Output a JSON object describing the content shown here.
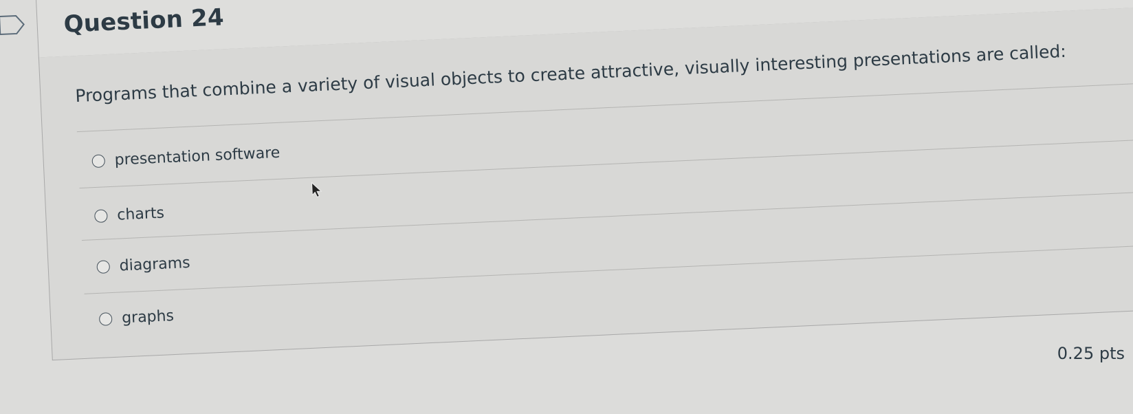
{
  "question": {
    "title": "Question 24",
    "text": "Programs that combine a variety of visual objects to create attractive, visually interesting presentations are called:",
    "points": "0.25 pts"
  },
  "options": [
    {
      "label": "presentation software",
      "selected": false
    },
    {
      "label": "charts",
      "selected": false
    },
    {
      "label": "diagrams",
      "selected": false
    },
    {
      "label": "graphs",
      "selected": false
    }
  ],
  "icons": {
    "flag": "flag-icon",
    "radio": "radio-button",
    "cursor": "mouse-pointer-icon"
  },
  "colors": {
    "text": "#2d3b45",
    "background": "#dcdcda",
    "border": "#a8a8a8"
  }
}
